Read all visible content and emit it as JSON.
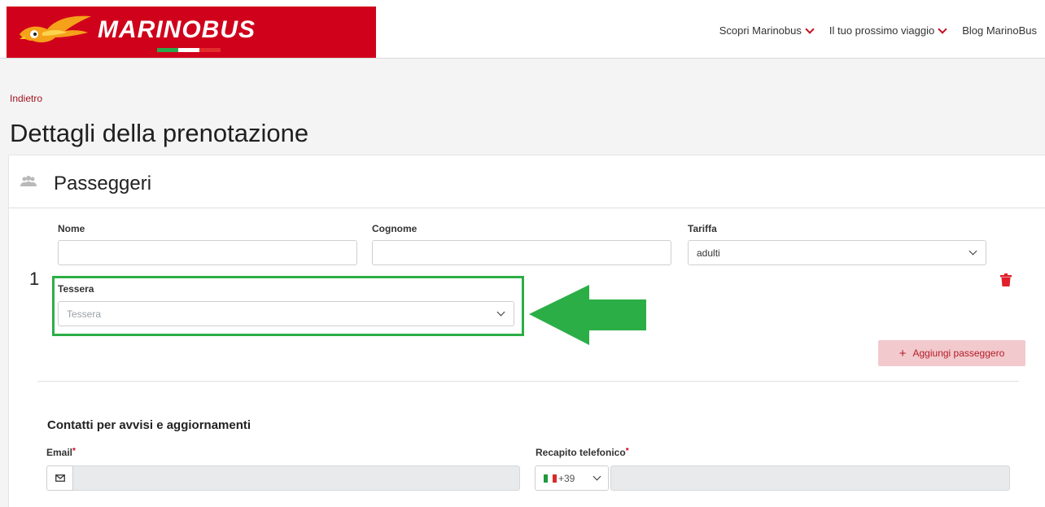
{
  "header": {
    "brand_name": "MARINOBUS",
    "brand_part1": "MARINO",
    "brand_part2": "BUS",
    "brand_color": "#d0021b",
    "nav": [
      {
        "label": "Scopri Marinobus",
        "has_dropdown": true
      },
      {
        "label": "Il tuo prossimo viaggio",
        "has_dropdown": true
      },
      {
        "label": "Blog MarinoBus",
        "has_dropdown": false
      }
    ]
  },
  "back_link": "Indietro",
  "page_title": "Dettagli della prenotazione",
  "passengers": {
    "title": "Passeggeri",
    "icon": "people-icon",
    "index": "1",
    "fields": {
      "nome_label": "Nome",
      "nome_value": "",
      "cognome_label": "Cognome",
      "cognome_value": "",
      "tariffa_label": "Tariffa",
      "tariffa_value": "adulti",
      "tessera_label": "Tessera",
      "tessera_placeholder": "Tessera"
    },
    "add_button": "Aggiungi passeggero",
    "add_icon": "+"
  },
  "annotation": {
    "highlight_color": "#2cae46",
    "arrow_color": "#2cae46"
  },
  "contacts": {
    "title": "Contatti per avvisi e aggiornamenti",
    "email_label": "Email",
    "phone_label": "Recapito telefonico",
    "required_mark": "*",
    "phone_prefix": "+39",
    "email_icon": "mail-icon",
    "phone_flag": "italy-flag-icon"
  }
}
